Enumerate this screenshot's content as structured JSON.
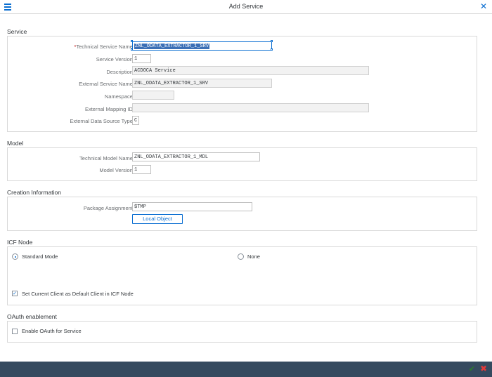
{
  "window": {
    "title": "Add Service"
  },
  "service": {
    "section_title": "Service",
    "required_marker": "*",
    "technical_service_name_label": "Technical Service Name:",
    "technical_service_name_value": "ZNL_ODATA_EXTRACTOR_1_SRV",
    "service_version_label": "Service Version:",
    "service_version_value": "1",
    "description_label": "Description:",
    "description_value": "ACDOCA Service",
    "external_service_name_label": "External Service Name:",
    "external_service_name_value": "ZNL_ODATA_EXTRACTOR_1_SRV",
    "namespace_label": "Namespace:",
    "namespace_value": "",
    "external_mapping_id_label": "External Mapping ID:",
    "external_mapping_id_value": "",
    "external_data_source_type_label": "External Data Source Type:",
    "external_data_source_type_value": "C"
  },
  "model": {
    "section_title": "Model",
    "technical_model_name_label": "Technical Model Name:",
    "technical_model_name_value": "ZNL_ODATA_EXTRACTOR_1_MDL",
    "model_version_label": "Model Version:",
    "model_version_value": "1"
  },
  "creation": {
    "section_title": "Creation Information",
    "package_assignment_label": "Package Assignment:",
    "package_assignment_value": "$TMP",
    "local_object_button": "Local Object"
  },
  "icf": {
    "section_title": "ICF Node",
    "standard_mode_label": "Standard Mode",
    "standard_mode_selected": true,
    "none_label": "None",
    "default_client_label": "Set Current Client as Default Client in ICF Node",
    "default_client_checked": true,
    "check_glyph": "✓"
  },
  "oauth": {
    "section_title": "OAuth enablement",
    "enable_label": "Enable OAuth for Service",
    "enable_checked": false
  },
  "icons": {
    "menu": "menu-icon",
    "close": "close-icon",
    "ok": "checkmark-icon",
    "cancel": "cancel-icon",
    "close_glyph": "✕",
    "ok_glyph": "✔",
    "cancel_glyph": "✖"
  },
  "colors": {
    "accent": "#0a6ed1",
    "footer": "#354a5f",
    "ok": "#2b7d2b",
    "cancel": "#e03b3b",
    "selection": "#3b6fb6"
  }
}
